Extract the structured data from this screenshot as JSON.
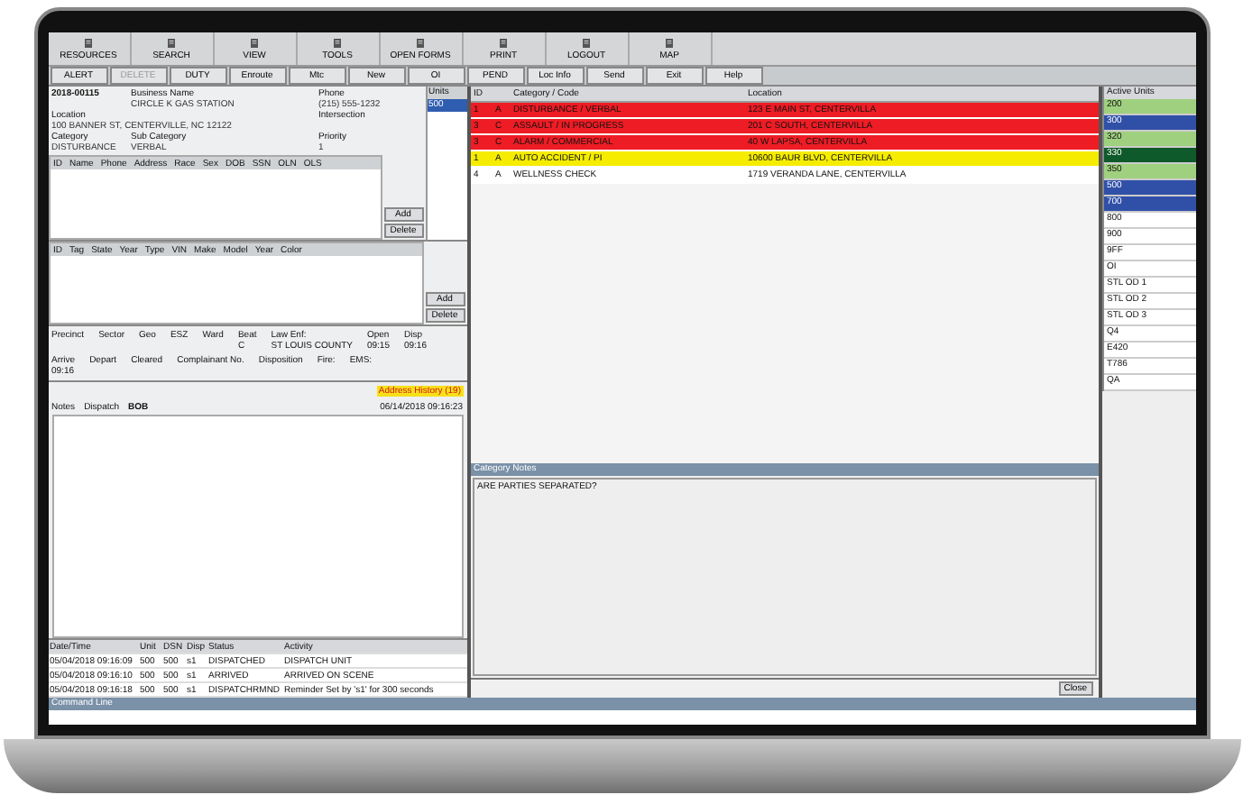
{
  "toolbar": [
    {
      "label": "RESOURCES"
    },
    {
      "label": "SEARCH"
    },
    {
      "label": "VIEW"
    },
    {
      "label": "TOOLS"
    },
    {
      "label": "OPEN FORMS"
    },
    {
      "label": "PRINT"
    },
    {
      "label": "LOGOUT"
    },
    {
      "label": "MAP"
    }
  ],
  "actions": [
    {
      "label": "ALERT",
      "disabled": false
    },
    {
      "label": "DELETE",
      "disabled": true
    },
    {
      "label": "DUTY",
      "disabled": false
    },
    {
      "label": "Enroute",
      "disabled": false
    },
    {
      "label": "Mtc",
      "disabled": false
    },
    {
      "label": "New",
      "disabled": false
    },
    {
      "label": "OI",
      "disabled": false
    },
    {
      "label": "PEND",
      "disabled": false
    },
    {
      "label": "Loc Info",
      "disabled": false
    },
    {
      "label": "Send",
      "disabled": false
    },
    {
      "label": "Exit",
      "disabled": false
    },
    {
      "label": "Help",
      "disabled": false
    }
  ],
  "call": {
    "number": "2018-00115",
    "fields": [
      {
        "label": "Business Name",
        "value": "CIRCLE K GAS STATION"
      },
      {
        "label": "Phone",
        "value": "(215) 555-1232"
      },
      {
        "label": "Location",
        "value": "100 BANNER ST, CENTERVILLE, NC 12122"
      },
      {
        "label": "Intersection"
      },
      {
        "label": "Category",
        "value": "DISTURBANCE"
      },
      {
        "label": "Sub Category",
        "value": "VERBAL"
      },
      {
        "label": "Priority",
        "value": "1"
      }
    ]
  },
  "units": {
    "header": "Units",
    "items": [
      {
        "label": "500",
        "selected": true
      }
    ]
  },
  "persons": {
    "columns": [
      "ID",
      "Name",
      "Phone",
      "Address",
      "Race",
      "Sex",
      "DOB",
      "SSN",
      "OLN",
      "OLS"
    ],
    "buttons": [
      "Add",
      "Delete"
    ]
  },
  "vehicles": {
    "columns": [
      "ID",
      "Tag",
      "State",
      "Year",
      "Type",
      "VIN",
      "Make",
      "Model",
      "Year",
      "Color"
    ],
    "buttons": [
      "Add",
      "Delete"
    ]
  },
  "location_fields": [
    {
      "label": "Precinct"
    },
    {
      "label": "Sector"
    },
    {
      "label": "Geo"
    },
    {
      "label": "ESZ"
    },
    {
      "label": "Ward"
    },
    {
      "label": "Beat",
      "value": "C"
    },
    {
      "label": "Law Enf:",
      "value": "ST LOUIS COUNTY"
    }
  ],
  "time_fields": [
    {
      "label": "Open",
      "value": "09:15"
    },
    {
      "label": "Disp",
      "value": "09:16"
    },
    {
      "label": "Arrive",
      "value": "09:16"
    },
    {
      "label": "Depart"
    },
    {
      "label": "Cleared"
    },
    {
      "label": "Complainant No."
    },
    {
      "label": "Disposition"
    },
    {
      "label": "Fire:"
    },
    {
      "label": "EMS:"
    }
  ],
  "address_history": "Address History (19)",
  "notes": {
    "label": "Notes",
    "dispatcher_label": "Dispatch",
    "dispatcher": "BOB",
    "timestamp": "06/14/2018 09:16:23"
  },
  "log": {
    "columns": [
      "Date/Time",
      "Unit",
      "DSN",
      "Disp",
      "Status",
      "Activity"
    ],
    "rows": [
      [
        "05/04/2018 09:16:09",
        "500",
        "500",
        "s1",
        "DISPATCHED",
        "DISPATCH UNIT"
      ],
      [
        "05/04/2018 09:16:10",
        "500",
        "500",
        "s1",
        "ARRIVED",
        "ARRIVED ON SCENE"
      ],
      [
        "05/04/2018 09:16:18",
        "500",
        "500",
        "s1",
        "DISPATCHRMND",
        "Reminder Set by 's1' for 300 seconds"
      ]
    ]
  },
  "command_line": "Command Line",
  "calls": {
    "columns": [
      "ID",
      "",
      "Category / Code",
      "Location"
    ],
    "rows": [
      {
        "id": "1",
        "code": "A",
        "category": "DISTURBANCE / VERBAL",
        "location": "123 E MAIN ST, CENTERVILLA",
        "color": "#ee1c24"
      },
      {
        "id": "3",
        "code": "C",
        "category": "ASSAULT / IN PROGRESS",
        "location": "201 C SOUTH, CENTERVILLA",
        "color": "#ee1c24"
      },
      {
        "id": "3",
        "code": "C",
        "category": "ALARM / COMMERCIAL",
        "location": "40 W LAPSA, CENTERVILLA",
        "color": "#ee1c24"
      },
      {
        "id": "1",
        "code": "A",
        "category": "AUTO ACCIDENT / PI",
        "location": "10600 BAUR BLVD, CENTERVILLA",
        "color": "#f5ec00"
      },
      {
        "id": "4",
        "code": "A",
        "category": "WELLNESS CHECK",
        "location": "1719 VERANDA LANE, CENTERVILLA",
        "color": "#ffffff"
      }
    ]
  },
  "category_notes": {
    "title": "Category Notes",
    "text": "ARE PARTIES SEPARATED?",
    "button": "Close"
  },
  "active_units": {
    "header": "Active Units",
    "items": [
      {
        "label": "200",
        "color": "#9fd07f"
      },
      {
        "label": "300",
        "color": "#3050a8"
      },
      {
        "label": "320",
        "color": "#9fd07f"
      },
      {
        "label": "330",
        "color": "#0f5a2a"
      },
      {
        "label": "350",
        "color": "#9fd07f"
      },
      {
        "label": "500",
        "color": "#3050a8"
      },
      {
        "label": "700",
        "color": "#3050a8"
      },
      {
        "label": "800",
        "color": "#ffffff"
      },
      {
        "label": "900",
        "color": "#ffffff"
      },
      {
        "label": "9FF",
        "color": "#ffffff"
      },
      {
        "label": "OI",
        "color": "#ffffff"
      },
      {
        "label": "STL OD 1",
        "color": "#ffffff"
      },
      {
        "label": "STL OD 2",
        "color": "#ffffff"
      },
      {
        "label": "STL OD 3",
        "color": "#ffffff"
      },
      {
        "label": "Q4",
        "color": "#ffffff"
      },
      {
        "label": "E420",
        "color": "#ffffff"
      },
      {
        "label": "T786",
        "color": "#ffffff"
      },
      {
        "label": "QA",
        "color": "#ffffff"
      }
    ]
  }
}
